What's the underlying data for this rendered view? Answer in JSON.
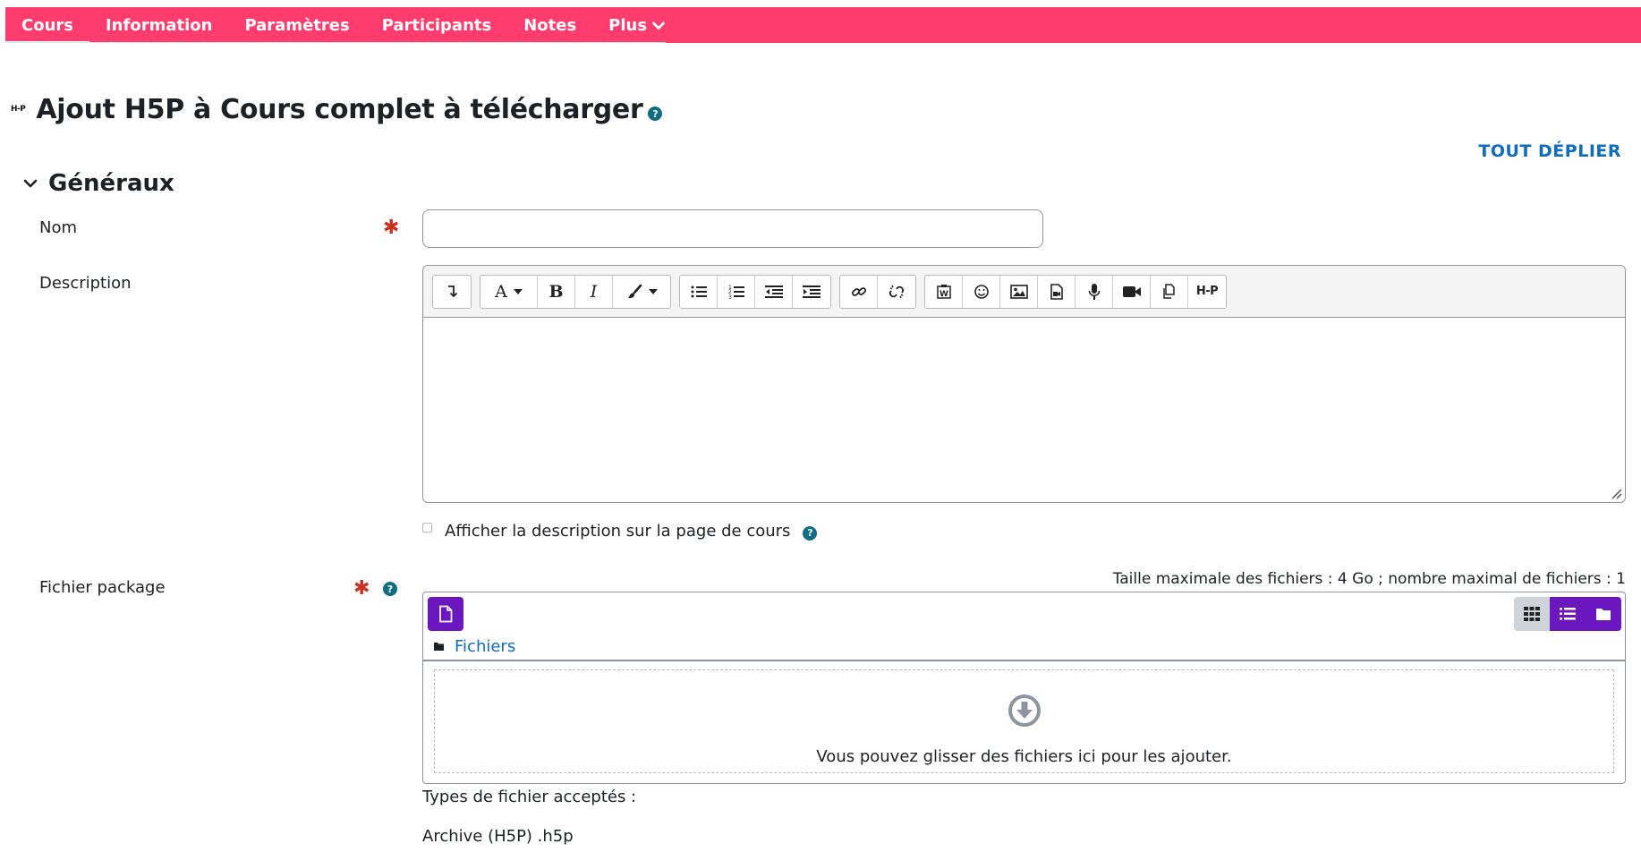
{
  "nav": {
    "tabs": [
      {
        "label": "Cours",
        "active": true
      },
      {
        "label": "Information"
      },
      {
        "label": "Paramètres"
      },
      {
        "label": "Participants"
      },
      {
        "label": "Notes"
      },
      {
        "label": "Plus",
        "icon": "chevron-down-icon"
      }
    ],
    "accent_color": "#ff3c6e"
  },
  "page": {
    "logo_text": "H-P",
    "title": "Ajout H5P à Cours complet à télécharger",
    "help_glyph": "?",
    "expand_all": "TOUT DÉPLIER"
  },
  "section": {
    "title": "Généraux"
  },
  "form": {
    "name": {
      "label": "Nom",
      "value": "",
      "required_mark": "✱"
    },
    "description": {
      "label": "Description",
      "toolbar_icons": [
        "expand-toolbar-icon",
        "font-style-icon",
        "bold-icon",
        "italic-icon",
        "text-color-icon",
        "bulleted-list-icon",
        "numbered-list-icon",
        "outdent-icon",
        "indent-icon",
        "link-icon",
        "unlink-icon",
        "word-paste-icon",
        "emoticon-icon",
        "image-icon",
        "media-icon",
        "record-audio-icon",
        "record-video-icon",
        "manage-files-icon",
        "h5p-icon"
      ],
      "toolbar_text": {
        "font": "A",
        "bold": "B",
        "italic": "I",
        "h5p": "H-P"
      },
      "value": ""
    },
    "show_description": {
      "label": "Afficher la description sur la page de cours",
      "checked": false
    },
    "package": {
      "label": "Fichier package",
      "required_mark": "✱",
      "limits": "Taille maximale des fichiers : 4 Go ; nombre maximal de fichiers : 1",
      "path_link": "Fichiers",
      "drop_text": "Vous pouvez glisser des fichiers ici pour les ajouter.",
      "accent_color": "#6a17bf"
    },
    "accepted_types": {
      "label": "Types de fichier acceptés :",
      "value": "Archive (H5P) .h5p"
    }
  }
}
